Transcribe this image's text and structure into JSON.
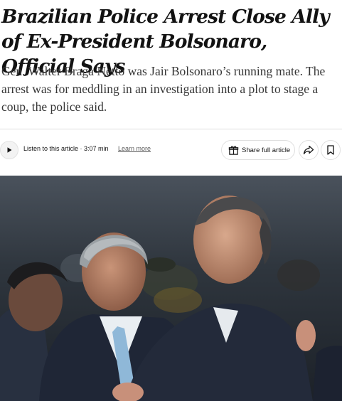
{
  "article": {
    "headline": "Brazilian Police Arrest Close Ally of Ex-President Bolsonaro, Official Says",
    "summary": "Gen. Walter Braga Netto was Jair Bolsonaro’s running mate. The arrest was for meddling in an investigation into a plot to stage a coup, the police said."
  },
  "audio": {
    "listen_label": "Listen to this article · 3:07 min",
    "learn_more": "Learn more",
    "play_icon": "play-icon"
  },
  "actions": {
    "share_full_article": "Share full article",
    "gift_icon": "gift-icon",
    "share_icon": "share-arrow-icon",
    "save_icon": "bookmark-icon"
  },
  "photo": {
    "subject": "news-photo"
  }
}
